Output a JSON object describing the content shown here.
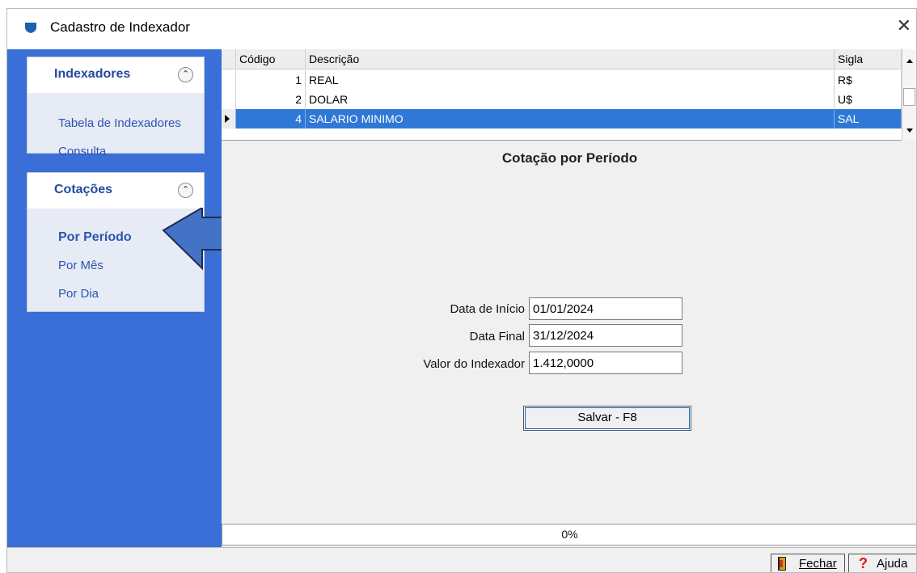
{
  "window": {
    "title": "Cadastro de Indexador",
    "close_label": "✕"
  },
  "sidebar": {
    "panels": [
      {
        "title": "Indexadores",
        "items": [
          "Tabela de Indexadores",
          "Consulta"
        ]
      },
      {
        "title": "Cotações",
        "items": [
          "Por Período",
          "Por Mês",
          "Por Dia"
        ],
        "active_item": "Por Período"
      }
    ]
  },
  "grid": {
    "columns": [
      "Código",
      "Descrição",
      "Sigla"
    ],
    "rows": [
      {
        "codigo": "1",
        "descricao": "REAL",
        "sigla": "R$"
      },
      {
        "codigo": "2",
        "descricao": "DOLAR",
        "sigla": "U$"
      },
      {
        "codigo": "4",
        "descricao": "SALARIO MINIMO",
        "sigla": "SAL",
        "selected": true
      }
    ]
  },
  "form": {
    "section_title": "Cotação por Período",
    "labels": {
      "start": "Data de Início",
      "end": "Data Final",
      "value": "Valor do Indexador"
    },
    "values": {
      "start": "01/01/2024",
      "end": "31/12/2024",
      "value": "1.412,0000"
    },
    "save_label": "Salvar - F8"
  },
  "progress": {
    "text": "0%",
    "value": 0
  },
  "statusbar": {
    "close_label": "Fechar",
    "help_label": "Ajuda"
  },
  "colors": {
    "sidebar": "#3a6fd8",
    "selection": "#2f78d6",
    "link": "#2b55b0",
    "arrow": "#4472c4"
  },
  "icons": [
    "shield-app-icon",
    "collapse-up-icon",
    "blue-arrow-pointer",
    "row-indicator-icon",
    "door-exit-icon",
    "help-question-icon"
  ]
}
